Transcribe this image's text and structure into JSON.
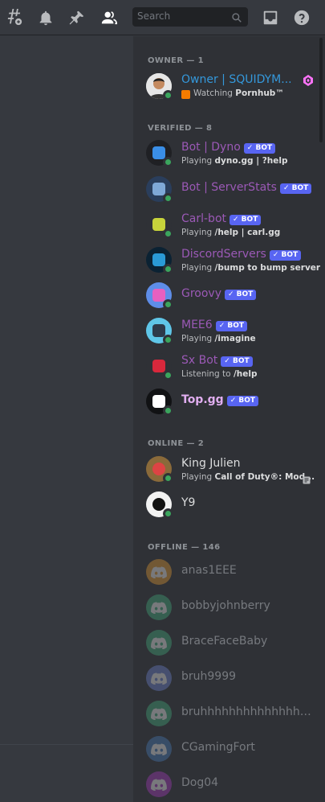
{
  "header": {
    "search_placeholder": "Search"
  },
  "sections": {
    "owner": "OWNER — 1",
    "verified": "VERIFIED — 8",
    "online": "ONLINE — 2",
    "offline": "OFFLINE — 146"
  },
  "bot_badge": "✓ BOT",
  "owner": {
    "name": "Owner | SQUIDYM...",
    "activity_prefix": "Watching",
    "activity_bold": "Pornhub™"
  },
  "verified": [
    {
      "name": "Bot | Dyno",
      "prefix": "Playing",
      "bold": "dyno.gg | ?help",
      "color": "#9b59b6",
      "avatar_bg": "#1f2024",
      "avatar_fg": "#3a8ee6"
    },
    {
      "name": "Bot | ServerStats",
      "prefix": "",
      "bold": "",
      "color": "#9b59b6",
      "avatar_bg": "#2a3e5c",
      "avatar_fg": "#7fa9d8"
    },
    {
      "name": "Carl-bot",
      "prefix": "Playing",
      "bold": "/help | carl.gg",
      "color": "#9b59b6",
      "avatar_bg": "#2f3136",
      "avatar_fg": "#c7d33b"
    },
    {
      "name": "DiscordServers",
      "prefix": "Playing",
      "bold": "/bump to bump server",
      "color": "#9b59b6",
      "avatar_bg": "#0b2233",
      "avatar_fg": "#2a9ad6"
    },
    {
      "name": "Groovy",
      "prefix": "",
      "bold": "",
      "color": "#9b59b6",
      "avatar_bg": "#5e8de8",
      "avatar_fg": "#e660c0"
    },
    {
      "name": "MEE6",
      "prefix": "Playing",
      "bold": "/imagine",
      "color": "#9b59b6",
      "avatar_bg": "#5fc6e8",
      "avatar_fg": "#2d3a4a"
    },
    {
      "name": "Sx Bot",
      "prefix": "Listening to",
      "bold": "/help",
      "color": "#9b59b6",
      "avatar_bg": "#2f3136",
      "avatar_fg": "#d8283c"
    },
    {
      "name": "Top.gg",
      "prefix": "",
      "bold": "",
      "color": "#e1aef0",
      "avatar_bg": "#111214",
      "avatar_fg": "#ffffff"
    }
  ],
  "online": [
    {
      "name": "King Julien",
      "prefix": "Playing",
      "bold": "Call of Duty®: Mod...",
      "avatar_bg": "#8a6a3a",
      "avatar_fg": "#d44"
    },
    {
      "name": "Y9",
      "prefix": "",
      "bold": "",
      "avatar_bg": "#f2f2f2",
      "avatar_fg": "#111"
    }
  ],
  "offline": [
    {
      "name": "anas1EEE",
      "avatar_bg": "#f0a232"
    },
    {
      "name": "bobbyjohnberry",
      "avatar_bg": "#43b581"
    },
    {
      "name": "BraceFaceBaby",
      "avatar_bg": "#43b581"
    },
    {
      "name": "bruh9999",
      "avatar_bg": "#7289da"
    },
    {
      "name": "bruhhhhhhhhhhhhhhhhhhh...",
      "avatar_bg": "#43b581"
    },
    {
      "name": "CGamingFort",
      "avatar_bg": "#4a82c4"
    },
    {
      "name": "Dog04",
      "avatar_bg": "#b03cc9"
    }
  ]
}
